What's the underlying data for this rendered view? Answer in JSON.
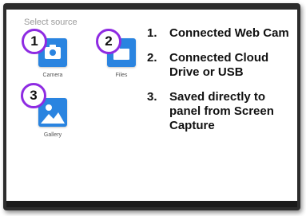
{
  "dialog": {
    "title": "Select source",
    "sources": [
      {
        "label": "Camera",
        "icon": "camera-icon",
        "badge": "1"
      },
      {
        "label": "Files",
        "icon": "folder-icon",
        "badge": "2"
      },
      {
        "label": "Gallery",
        "icon": "image-icon",
        "badge": "3"
      }
    ]
  },
  "annotations": {
    "badge_color": "#8e2be2",
    "tile_color": "#2a84e0",
    "items": [
      {
        "number": "1.",
        "text": "Connected Web Cam"
      },
      {
        "number": "2.",
        "text": "Connected Cloud Drive or USB"
      },
      {
        "number": "3.",
        "text": "Saved directly to panel from Screen Capture"
      }
    ]
  }
}
